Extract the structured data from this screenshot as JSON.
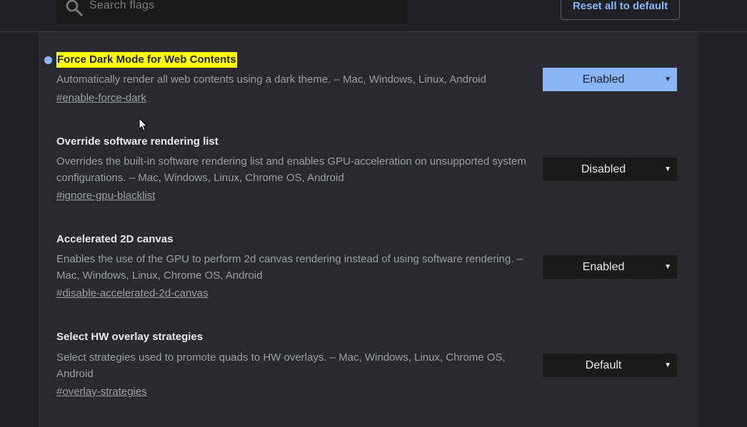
{
  "header": {
    "search_placeholder": "Search flags",
    "reset_label": "Reset all to default"
  },
  "flags": [
    {
      "title": "Force Dark Mode for Web Contents",
      "description": "Automatically render all web contents using a dark theme. – Mac, Windows, Linux, Android",
      "link": "#enable-force-dark",
      "value": "Enabled",
      "highlighted": true,
      "modified": true
    },
    {
      "title": "Override software rendering list",
      "description": "Overrides the built-in software rendering list and enables GPU-acceleration on unsupported system configurations. – Mac, Windows, Linux, Chrome OS, Android",
      "link": "#ignore-gpu-blacklist",
      "value": "Disabled"
    },
    {
      "title": "Accelerated 2D canvas",
      "description": "Enables the use of the GPU to perform 2d canvas rendering instead of using software rendering. – Mac, Windows, Linux, Chrome OS, Android",
      "link": "#disable-accelerated-2d-canvas",
      "value": "Enabled"
    },
    {
      "title": "Select HW overlay strategies",
      "description": "Select strategies used to promote quads to HW overlays. – Mac, Windows, Linux, Chrome OS, Android",
      "link": "#overlay-strategies",
      "value": "Default"
    }
  ],
  "select_arrow": "▼",
  "colors": {
    "background": "#202124",
    "panel": "#292a2d",
    "accent": "#8ab4f8",
    "highlight": "#ffff00"
  }
}
